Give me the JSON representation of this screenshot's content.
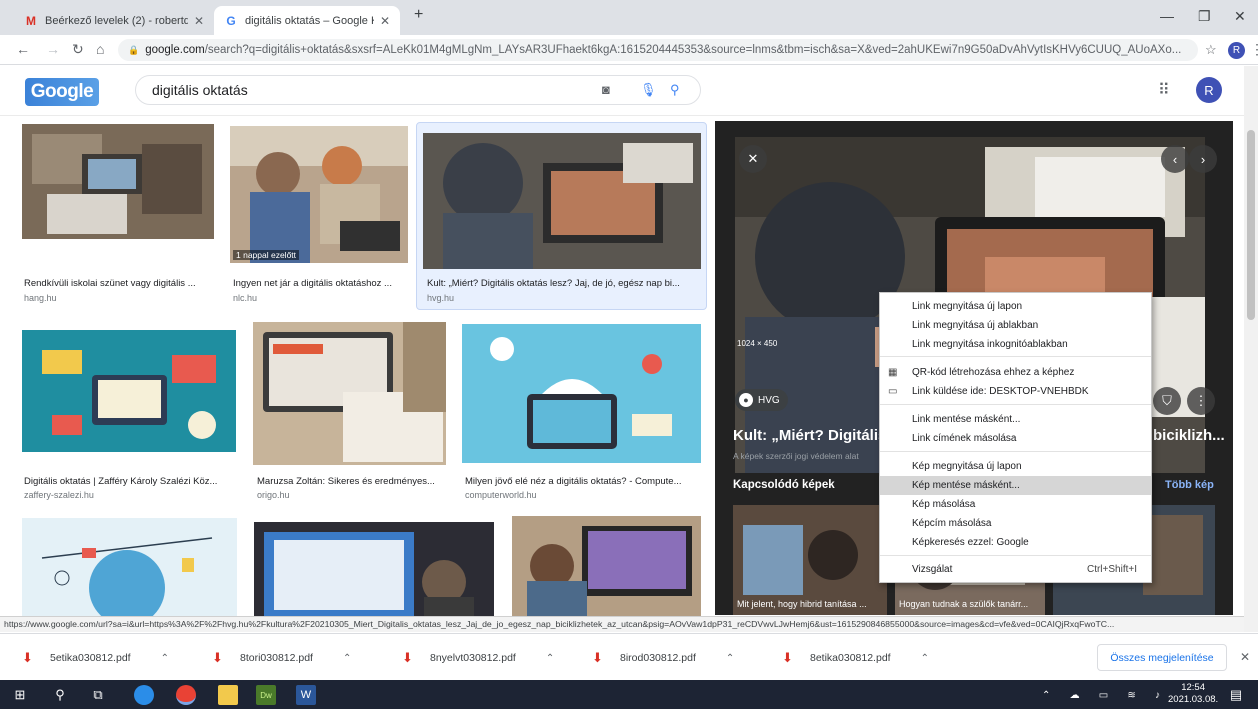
{
  "tabs": [
    {
      "label": "Beérkező levelek (2) - robertden",
      "icon": "gmail-icon"
    },
    {
      "label": "digitális oktatás – Google Kereső",
      "icon": "google-icon"
    }
  ],
  "new_tab": "+",
  "omnibox": {
    "host": "google.com",
    "path": "/search?q=digitális+oktatás&sxsrf=ALeKk01M4gMLgNm_LAYsAR3UFhaekt6kgA:1615204445353&source=lnms&tbm=isch&sa=X&ved=2ahUKEwi7n9G50aDvAhVytIsKHVy6CUUQ_AUoAXo..."
  },
  "profile_initial": "R",
  "google": {
    "logo": "Google",
    "query": "digitális oktatás"
  },
  "results": [
    {
      "caption": "Rendkívüli iskolai szünet vagy digitális ...",
      "source": "hang.hu"
    },
    {
      "caption": "Ingyen net jár a digitális oktatáshoz ...",
      "source": "nlc.hu",
      "badge": "1 nappal ezelőtt"
    },
    {
      "caption": "Kult: „Miért? Digitális oktatás lesz? Jaj, de jó, egész nap bi...",
      "source": "hvg.hu"
    },
    {
      "caption": "Digitális oktatás | Zafféry Károly Szalézi Köz...",
      "source": "zaffery-szalezi.hu"
    },
    {
      "caption": "Maruzsa Zoltán: Sikeres és eredményes...",
      "source": "origo.hu"
    },
    {
      "caption": "Milyen jövő elé néz a digitális oktatás? - Compute...",
      "source": "computerworld.hu"
    }
  ],
  "panel": {
    "size": "1024 × 450",
    "source_name": "HVG",
    "title_left": "Kult: „Miért? Digitális",
    "title_right": "biciklizh...",
    "copyright": "A képek szerzői jogi védelem alat",
    "related": "Kapcsolódó képek",
    "more": "Több kép",
    "related_captions": [
      "Mit jelent, hogy hibrid tanítása ...",
      "Hogyan tudnak a szülők tanárr..."
    ]
  },
  "context_menu": [
    {
      "label": "Link megnyitása új lapon"
    },
    {
      "label": "Link megnyitása új ablakban"
    },
    {
      "label": "Link megnyitása inkognitóablakban"
    },
    {
      "label": "QR-kód létrehozása ehhez a képhez",
      "icon": "qr-icon"
    },
    {
      "label": "Link küldése ide: DESKTOP-VNEHBDK",
      "icon": "device-icon"
    },
    {
      "label": "Link mentése másként..."
    },
    {
      "label": "Link címének másolása"
    },
    {
      "label": "Kép megnyitása új lapon"
    },
    {
      "label": "Kép mentése másként..."
    },
    {
      "label": "Kép másolása"
    },
    {
      "label": "Képcím másolása"
    },
    {
      "label": "Képkeresés ezzel: Google"
    },
    {
      "label": "Vizsgálat",
      "shortcut": "Ctrl+Shift+I"
    }
  ],
  "status_url": "https://www.google.com/url?sa=i&url=https%3A%2F%2Fhvg.hu%2Fkultura%2F20210305_Miert_Digitalis_oktatas_lesz_Jaj_de_jo_egesz_nap_biciklizhetek_az_utcan&psig=AOvVaw1dpP31_reCDVwvLJwHemj6&ust=1615290846855000&source=images&cd=vfe&ved=0CAIQjRxqFwoTC...",
  "downloads": [
    {
      "name": "5etika030812.pdf"
    },
    {
      "name": "8tori030812.pdf"
    },
    {
      "name": "8nyelvt030812.pdf"
    },
    {
      "name": "8irod030812.pdf"
    },
    {
      "name": "8etika030812.pdf"
    }
  ],
  "show_all": "Összes megjelenítése",
  "clock": {
    "time": "12:54",
    "date": "2021.03.08."
  }
}
